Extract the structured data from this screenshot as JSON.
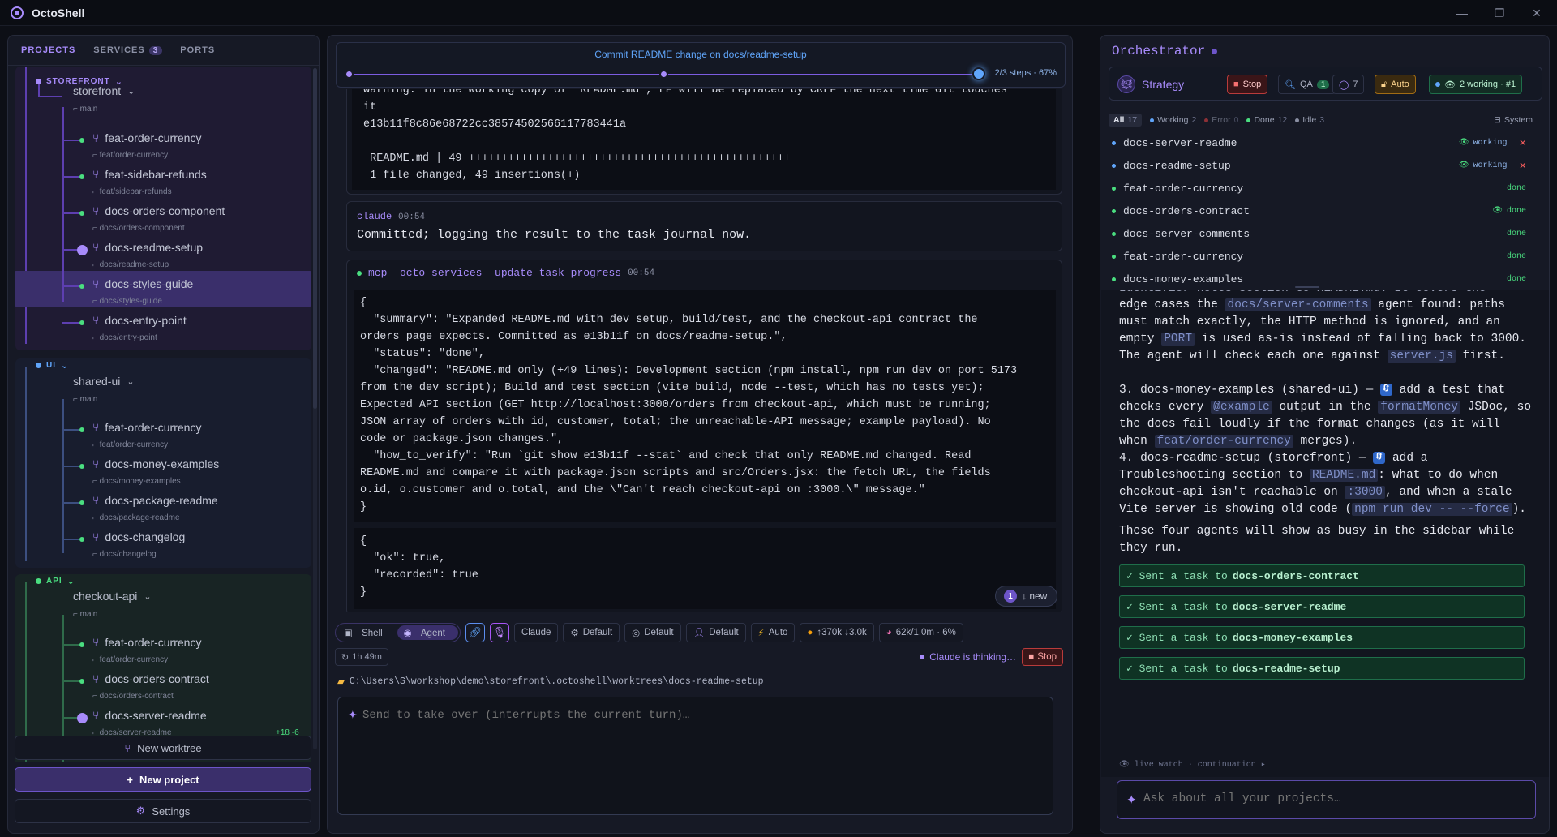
{
  "app": {
    "title": "OctoShell",
    "window_controls": [
      "—",
      "❐",
      "✕"
    ]
  },
  "sidebar": {
    "tabs": [
      {
        "label": "PROJECTS",
        "active": true
      },
      {
        "label": "SERVICES",
        "badge": "3"
      },
      {
        "label": "PORTS"
      }
    ],
    "groups": [
      {
        "name": "STOREFRONT",
        "color": "#a78bfa",
        "repo": "storefront",
        "main": "main",
        "worktrees": [
          {
            "name": "feat-order-currency",
            "branch": "feat/order-currency"
          },
          {
            "name": "feat-sidebar-refunds",
            "branch": "feat/sidebar-refunds"
          },
          {
            "name": "docs-orders-component",
            "branch": "docs/orders-component"
          },
          {
            "name": "docs-readme-setup",
            "branch": "docs/readme-setup",
            "selected": true
          },
          {
            "name": "docs-styles-guide",
            "branch": "docs/styles-guide"
          },
          {
            "name": "docs-entry-point",
            "branch": "docs/entry-point"
          }
        ]
      },
      {
        "name": "UI",
        "color": "#60a5fa",
        "repo": "shared-ui",
        "main": "main",
        "worktrees": [
          {
            "name": "feat-order-currency",
            "branch": "feat/order-currency"
          },
          {
            "name": "docs-money-examples",
            "branch": "docs/money-examples"
          },
          {
            "name": "docs-package-readme",
            "branch": "docs/package-readme"
          },
          {
            "name": "docs-changelog",
            "branch": "docs/changelog"
          }
        ]
      },
      {
        "name": "API",
        "color": "#4ade80",
        "repo": "checkout-api",
        "main": "main",
        "worktrees": [
          {
            "name": "feat-order-currency",
            "branch": "feat/order-currency"
          },
          {
            "name": "docs-orders-contract",
            "branch": "docs/orders-contract"
          },
          {
            "name": "docs-server-readme",
            "branch": "docs/server-readme",
            "diff": "+18 -6"
          }
        ]
      }
    ],
    "buttons": {
      "new_worktree": "New worktree",
      "new_project": "New project",
      "settings": "Settings"
    }
  },
  "center": {
    "progress": {
      "title": "Commit README change on docs/readme-setup",
      "label": "2/3 steps · 67%",
      "value": 0.67
    },
    "git_output": "warning: in the working copy of 'README.md', LF will be replaced by CRLF the next time Git touches\nit\ne13b11f8c86e68722cc38574502566117783441a\n\n README.md | 49 +++++++++++++++++++++++++++++++++++++++++++++++++\n 1 file changed, 49 insertions(+)",
    "assistant_msg": {
      "label": "claude",
      "time": "00:54",
      "text": "Committed; logging the result to the task journal now."
    },
    "tool_call": {
      "name": "mcp__octo_services__update_task_progress",
      "time": "00:54",
      "input": "{\n  \"summary\": \"Expanded README.md with dev setup, build/test, and the checkout-api contract the\norders page expects. Committed as e13b11f on docs/readme-setup.\",\n  \"status\": \"done\",\n  \"changed\": \"README.md only (+49 lines): Development section (npm install, npm run dev on port 5173\nfrom the dev script); Build and test section (vite build, node --test, which has no tests yet);\nExpected API section (GET http://localhost:3000/orders from checkout-api, which must be running;\nJSON array of orders with id, customer, total; the unreachable-API message; example payload). No\ncode or package.json changes.\",\n  \"how_to_verify\": \"Run `git show e13b11f --stat` and check that only README.md changed. Read\nREADME.md and compare it with package.json scripts and src/Orders.jsx: the fetch URL, the fields\no.id, o.customer and o.total, and the \\\"Can't reach checkout-api on :3000.\\\" message.\"\n}",
      "output": "{\n  \"ok\": true,\n  \"recorded\": true\n}"
    },
    "new_badge": {
      "count": "1",
      "label": "↓ new"
    },
    "toolbar": {
      "shell": "Shell",
      "agent": "Agent",
      "model": "Claude",
      "opt1": "Default",
      "opt2": "Default",
      "opt3": "Default",
      "mode": "Auto",
      "tokens": "↑370k ↓3.0k",
      "context": "62k/1.0m · 6%"
    },
    "status": {
      "elapsed": "1h 49m",
      "thinking": "Claude is thinking…",
      "stop": "Stop"
    },
    "path": "C:\\Users\\S\\workshop\\demo\\storefront\\.octoshell\\worktrees\\docs-readme-setup",
    "composer_placeholder": "Send to take over (interrupts the current turn)…"
  },
  "right": {
    "title": "Orchestrator",
    "strategy": "Strategy",
    "buttons": {
      "stop": "Stop",
      "qa": "QA",
      "qa_count": "1",
      "msgs": "7",
      "auto": "Auto",
      "working": "2 working · #1"
    },
    "filters": [
      {
        "label": "All",
        "count": "17",
        "active": true
      },
      {
        "label": "Working",
        "count": "2",
        "color": "#60a5fa"
      },
      {
        "label": "Error",
        "count": "0",
        "color": "#ef4444"
      },
      {
        "label": "Done",
        "count": "12",
        "color": "#4ade80"
      },
      {
        "label": "Idle",
        "count": "3",
        "color": "#8a8fa3"
      },
      {
        "label": "System"
      }
    ],
    "tasks": [
      {
        "name": "docs-server-readme",
        "state": "working",
        "color": "#60a5fa"
      },
      {
        "name": "docs-readme-setup",
        "state": "working",
        "color": "#60a5fa"
      },
      {
        "name": "feat-order-currency",
        "state": "done",
        "color": "#4ade80"
      },
      {
        "name": "docs-orders-contract",
        "state": "done",
        "color": "#4ade80"
      },
      {
        "name": "docs-server-comments",
        "state": "done",
        "color": "#4ade80"
      },
      {
        "name": "feat-order-currency",
        "state": "done",
        "color": "#4ade80"
      },
      {
        "name": "docs-money-examples",
        "state": "done",
        "color": "#4ade80"
      }
    ],
    "chat": {
      "p0_cut": "Identifier notes section to README.md. It covers the",
      "p1": [
        "edge cases the ",
        "docs/server-comments",
        " agent found: paths must match exactly, the HTTP method is ignored, and an empty ",
        "PORT",
        " is used as-is instead of falling back to 3000. The agent will check each one against ",
        "server.js",
        " first."
      ],
      "p2": [
        "3. docs-money-examples (shared-ui) — ",
        " add a test that checks every ",
        "@example",
        " output in the ",
        "formatMoney",
        " JSDoc, so the docs fail loudly if the format changes (as it will when ",
        "feat/order-currency",
        " merges)."
      ],
      "p3": [
        "4. docs-readme-setup (storefront) — ",
        " add a Troubleshooting section to ",
        "README.md",
        ": what to do when checkout-api isn't reachable on ",
        ":3000",
        ", and when a stale Vite server is showing old code (",
        "npm run dev -- --force",
        ")."
      ],
      "p4": "These four agents will show as busy in the sidebar while they run.",
      "sent_prefix": "✓ Sent a task to",
      "sent": [
        "docs-orders-contract",
        "docs-server-readme",
        "docs-money-examples",
        "docs-readme-setup"
      ],
      "live_watch": "👁 live watch · continuation ▸"
    },
    "ask_placeholder": "Ask about all your projects…"
  }
}
